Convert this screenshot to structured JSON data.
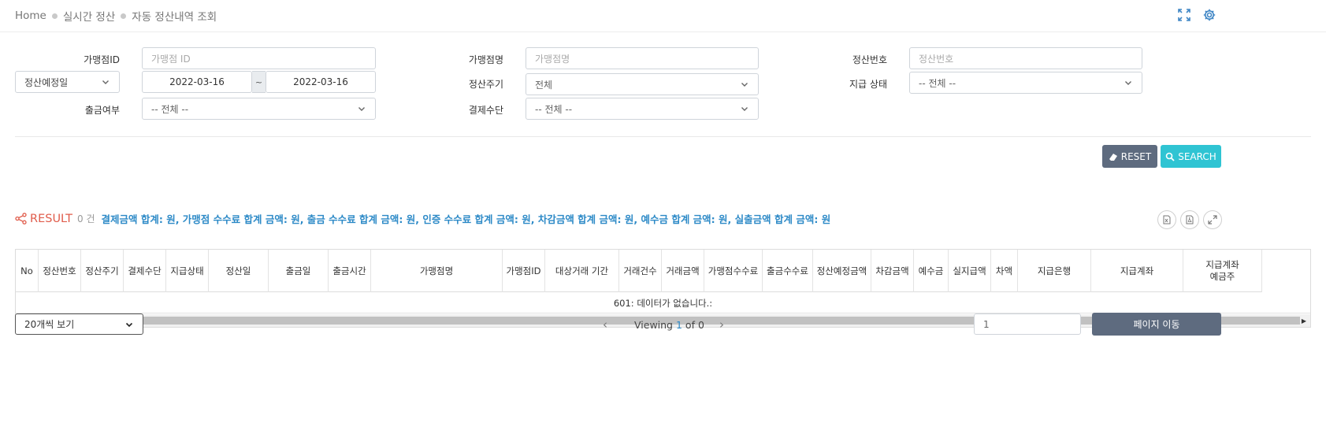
{
  "breadcrumb": {
    "home": "Home",
    "level1": "실시간 정산",
    "level2": "자동 정산내역 조회"
  },
  "filters": {
    "merchant_id_label": "가맹점ID",
    "merchant_id_placeholder": "가맹점 ID",
    "merchant_name_label": "가맹점명",
    "merchant_name_placeholder": "가맹점명",
    "settle_no_label": "정산번호",
    "settle_no_placeholder": "정산번호",
    "date_type_value": "정산예정일",
    "date_from": "2022-03-16",
    "date_sep": "~",
    "date_to": "2022-03-16",
    "cycle_label": "정산주기",
    "cycle_value": "전체",
    "pay_status_label": "지급 상태",
    "pay_status_value": "-- 전체 --",
    "withdraw_label": "출금여부",
    "withdraw_value": "-- 전체 --",
    "method_label": "결제수단",
    "method_value": "-- 전체 --"
  },
  "buttons": {
    "reset": "RESET",
    "search": "SEARCH"
  },
  "result": {
    "title": "RESULT",
    "count": "0 건",
    "summary": "결제금액 합계: 원, 가맹점 수수료 합계 금액: 원, 출금 수수료 합계 금액: 원, 인증 수수료 합계 금액: 원, 차감금액 합계 금액: 원, 예수금 합계 금액: 원, 실출금액 합계 금액: 원"
  },
  "table": {
    "columns": [
      "No",
      "정산번호",
      "정산주기",
      "결제수단",
      "지급상태",
      "정산일",
      "출금일",
      "출금시간",
      "가맹점명",
      "가맹점ID",
      "대상거래 기간",
      "거래건수",
      "거래금액",
      "가맹점수수료",
      "출금수수료",
      "정산예정금액",
      "차감금액",
      "예수금",
      "실지급액",
      "차액",
      "지급은행",
      "지급계좌",
      "지급계좌\n예금주"
    ],
    "empty_message": "601: 데이터가 없습니다.:"
  },
  "pagination": {
    "page_size_value": "20개씩 보기",
    "viewing_prefix": "Viewing",
    "current_page": "1",
    "viewing_suffix": "of 0",
    "page_input_value": "1",
    "goto_label": "페이지 이동"
  },
  "colors": {
    "accent_blue": "#2d8ac7",
    "reset_btn": "#5e6b7f",
    "search_btn": "#2fc4d3",
    "result_red": "#e05c4b"
  },
  "icons": [
    "fullscreen-icon",
    "gear-icon",
    "chevron-down-icon",
    "eraser-icon",
    "search-icon",
    "share-icon",
    "excel-icon",
    "pdf-icon",
    "expand-icon",
    "chevron-left-icon",
    "chevron-right-icon"
  ]
}
